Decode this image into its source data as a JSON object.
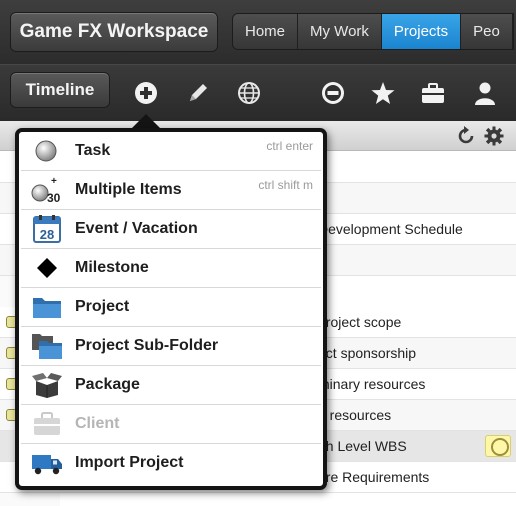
{
  "header": {
    "brand": "Game FX Workspace",
    "tabs": [
      {
        "label": "Home",
        "active": false
      },
      {
        "label": "My Work",
        "active": false
      },
      {
        "label": "Projects",
        "active": true
      },
      {
        "label": "Peo",
        "active": false
      }
    ]
  },
  "toolbar": {
    "timeline_label": "Timeline",
    "icons": [
      "plus-circle-icon",
      "pencil-icon",
      "globe-icon",
      "minus-circle-icon",
      "star-icon",
      "briefcase-icon",
      "user-icon"
    ]
  },
  "list": {
    "rows": [
      {
        "text": ""
      },
      {
        "text": ""
      },
      {
        "text": "Development Schedule"
      },
      {
        "text": ""
      },
      {
        "text": "project scope"
      },
      {
        "text": "ect sponsorship"
      },
      {
        "text": "minary resources"
      },
      {
        "text": "e resources"
      },
      {
        "text": "gh Level WBS"
      },
      {
        "text": "are Requirements"
      }
    ]
  },
  "menu": {
    "items": [
      {
        "label": "Task",
        "shortcut": "ctrl enter",
        "icon": "task-circle-icon",
        "enabled": true
      },
      {
        "label": "Multiple Items",
        "shortcut": "ctrl shift m",
        "icon": "multiple-items-icon",
        "icon_text": "30",
        "enabled": true
      },
      {
        "label": "Event / Vacation",
        "shortcut": "",
        "icon": "calendar-icon",
        "icon_text": "28",
        "enabled": true
      },
      {
        "label": "Milestone",
        "shortcut": "",
        "icon": "diamond-icon",
        "enabled": true
      },
      {
        "label": "Project",
        "shortcut": "",
        "icon": "folder-icon",
        "enabled": true
      },
      {
        "label": "Project Sub-Folder",
        "shortcut": "",
        "icon": "sub-folder-icon",
        "enabled": true
      },
      {
        "label": "Package",
        "shortcut": "",
        "icon": "package-box-icon",
        "enabled": true
      },
      {
        "label": "Client",
        "shortcut": "",
        "icon": "briefcase-icon",
        "enabled": false
      },
      {
        "label": "Import Project",
        "shortcut": "",
        "icon": "truck-icon",
        "enabled": true
      }
    ]
  },
  "colors": {
    "active_tab": "#1b84cf",
    "folder_blue": "#3a85c8",
    "disabled_text": "#b5b5b5"
  }
}
